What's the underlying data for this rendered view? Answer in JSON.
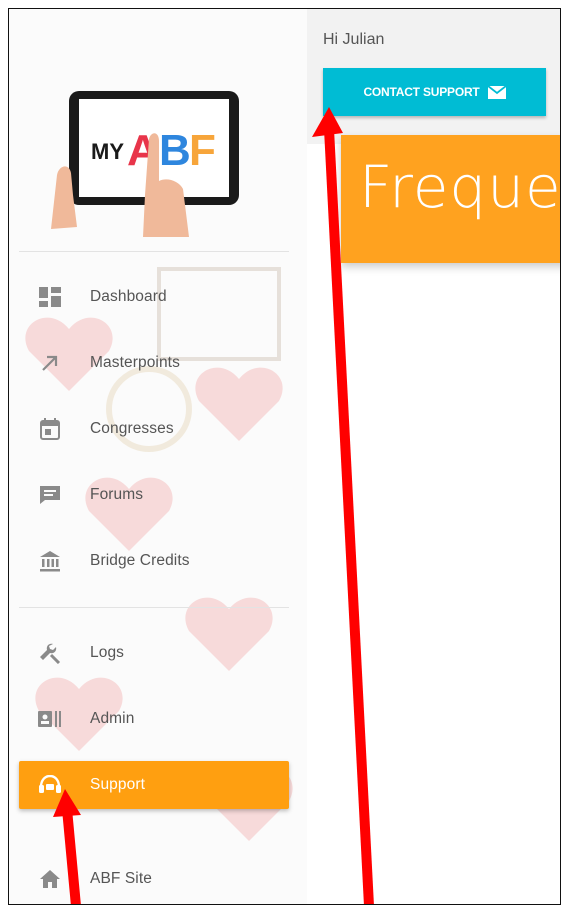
{
  "logo": {
    "prefix": "MY",
    "brand": "ABF"
  },
  "sidebar": {
    "items": [
      {
        "label": "Dashboard",
        "icon": "dashboard-icon"
      },
      {
        "label": "Masterpoints",
        "icon": "trending-arrow-icon"
      },
      {
        "label": "Congresses",
        "icon": "calendar-icon"
      },
      {
        "label": "Forums",
        "icon": "forum-icon"
      },
      {
        "label": "Bridge Credits",
        "icon": "bank-icon"
      },
      {
        "label": "Logs",
        "icon": "wrench-icon"
      },
      {
        "label": "Admin",
        "icon": "admin-id-icon"
      },
      {
        "label": "Support",
        "icon": "support-icon",
        "active": true
      },
      {
        "label": "ABF Site",
        "icon": "home-icon"
      }
    ]
  },
  "main": {
    "greeting": "Hi Julian",
    "contact_button": "CONTACT SUPPORT",
    "faq_title": "Frequer"
  },
  "colors": {
    "accent_orange": "#ff9f10",
    "button_cyan": "#00bcd4",
    "annotation_red": "#ff0000"
  }
}
